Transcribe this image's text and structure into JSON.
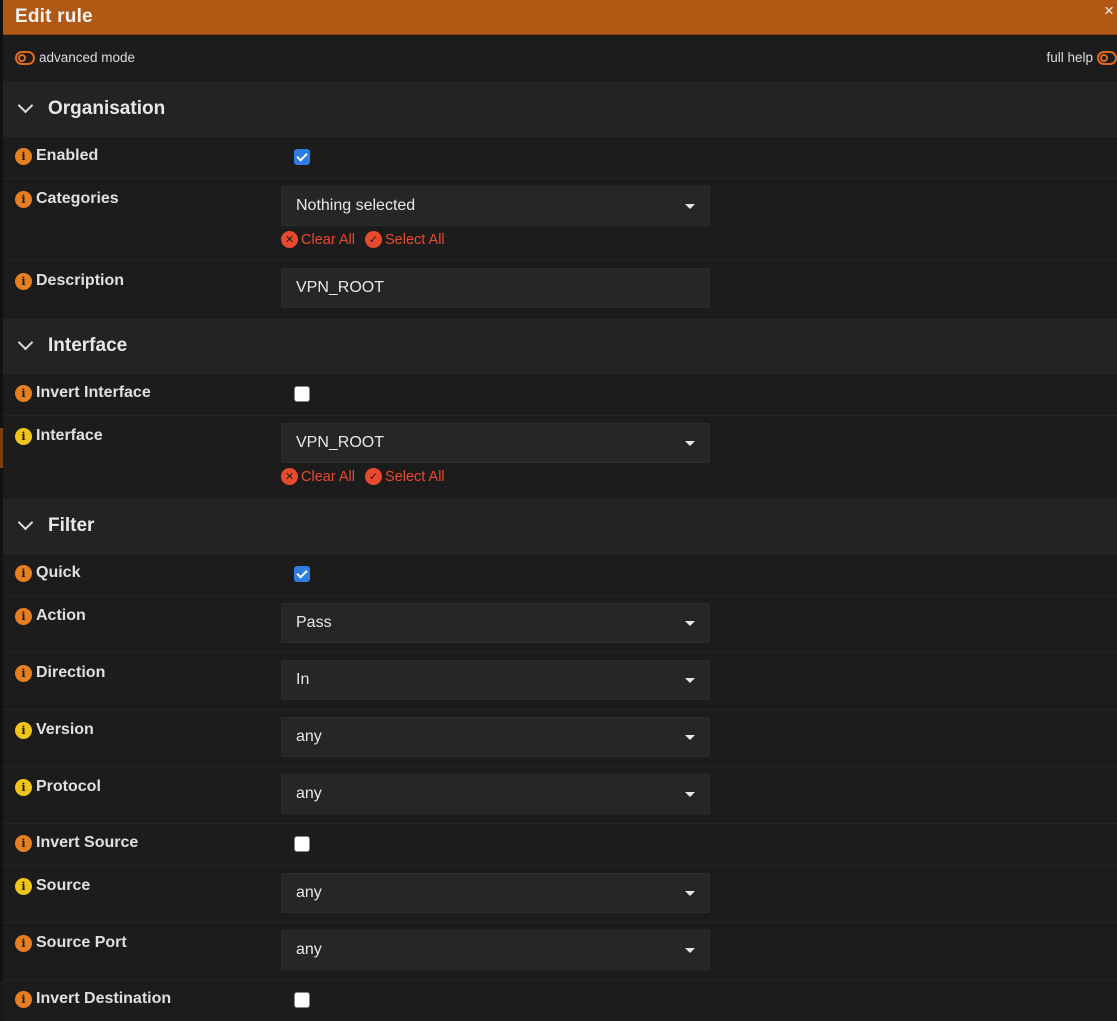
{
  "dialog": {
    "title": "Edit rule",
    "close_symbol": "×"
  },
  "mode_bar": {
    "advanced_mode_label": "advanced mode",
    "full_help_label": "full help"
  },
  "common": {
    "clear_all": "Clear All",
    "select_all": "Select All"
  },
  "sections": {
    "organisation": {
      "title": "Organisation",
      "enabled": {
        "label": "Enabled",
        "checked": true
      },
      "categories": {
        "label": "Categories",
        "value": "Nothing selected"
      },
      "description": {
        "label": "Description",
        "value": "VPN_ROOT"
      }
    },
    "interface": {
      "title": "Interface",
      "invert_interface": {
        "label": "Invert Interface",
        "checked": false
      },
      "interface": {
        "label": "Interface",
        "value": "VPN_ROOT"
      }
    },
    "filter": {
      "title": "Filter",
      "quick": {
        "label": "Quick",
        "checked": true
      },
      "action": {
        "label": "Action",
        "value": "Pass"
      },
      "direction": {
        "label": "Direction",
        "value": "In"
      },
      "version": {
        "label": "Version",
        "value": "any"
      },
      "protocol": {
        "label": "Protocol",
        "value": "any"
      },
      "invert_source": {
        "label": "Invert Source",
        "checked": false
      },
      "source": {
        "label": "Source",
        "value": "any"
      },
      "source_port": {
        "label": "Source Port",
        "value": "any"
      },
      "invert_destination": {
        "label": "Invert Destination",
        "checked": false
      }
    }
  },
  "colors": {
    "header_bg": "#b25815",
    "accent_orange": "#e06b1d",
    "info_orange": "#e67e22",
    "info_yellow": "#f0c419",
    "link_red": "#e84a2f",
    "checkbox_blue": "#2f7de1"
  },
  "icons": {
    "info": "info-icon",
    "toggle": "toggle-off-icon",
    "chevron": "chevron-down-icon",
    "clear": "clear-x-icon",
    "select": "check-circle-icon",
    "close": "close-icon"
  }
}
